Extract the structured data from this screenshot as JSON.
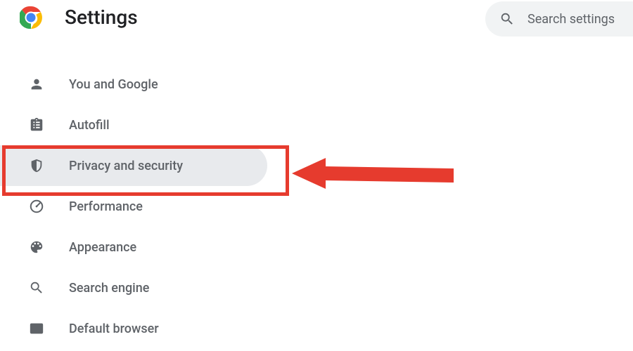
{
  "header": {
    "title": "Settings",
    "search_placeholder": "Search settings"
  },
  "sidebar": {
    "items": [
      {
        "id": "you-and-google",
        "label": "You and Google",
        "icon": "person-icon",
        "selected": false
      },
      {
        "id": "autofill",
        "label": "Autofill",
        "icon": "clipboard-icon",
        "selected": false
      },
      {
        "id": "privacy-and-security",
        "label": "Privacy and security",
        "icon": "shield-icon",
        "selected": true
      },
      {
        "id": "performance",
        "label": "Performance",
        "icon": "gauge-icon",
        "selected": false
      },
      {
        "id": "appearance",
        "label": "Appearance",
        "icon": "palette-icon",
        "selected": false
      },
      {
        "id": "search-engine",
        "label": "Search engine",
        "icon": "search-icon",
        "selected": false
      },
      {
        "id": "default-browser",
        "label": "Default browser",
        "icon": "browser-icon",
        "selected": false
      }
    ]
  },
  "annotation": {
    "highlight_target": "privacy-and-security",
    "highlight_color": "#e63b2e"
  }
}
